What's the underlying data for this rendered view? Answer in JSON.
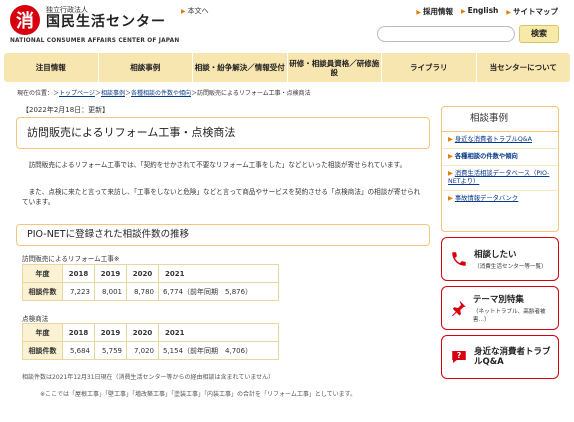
{
  "header": {
    "logo_mark": "消",
    "org_sub": "独立行政法人",
    "org_name": "国民生活センター",
    "org_en": "NATIONAL CONSUMER AFFAIRS CENTER OF JAPAN",
    "honbun": "本文へ",
    "links": [
      "採用情報",
      "English",
      "サイトマップ"
    ],
    "search_placeholder": "",
    "search_button": "検索"
  },
  "nav": [
    "注目情報",
    "相談事例",
    "相談・紛争解決／情報受付",
    "研修・相談員資格／研修施設",
    "ライブラリ",
    "当センターについて"
  ],
  "breadcrumb": {
    "prefix": "現在の位置：",
    "items": [
      "トップページ",
      "相談事例",
      "各種相談の件数や傾向"
    ],
    "current": "訪問販売によるリフォーム工事・点検商法"
  },
  "article": {
    "date": "【2022年2月18日：更新】",
    "title": "訪問販売によるリフォーム工事・点検商法",
    "para1": "　訪問販売によるリフォーム工事では、「契約をせかされて不要なリフォーム工事をした」などといった相談が寄せられています。",
    "para2": "　また、点検に来たと言って来訪し、「工事をしないと危険」などと言って商品やサービスを契約させる「点検商法」の相談が寄せられています。",
    "section_title": "PIO-NETに登録された相談件数の推移",
    "table1_label": "訪問販売によるリフォーム工事※",
    "table2_label": "点検商法",
    "years_label": "年度",
    "count_label": "相談件数",
    "years": [
      "2018",
      "2019",
      "2020",
      "2021"
    ],
    "table1_values": [
      "7,223",
      "8,001",
      "8,780",
      "6,774（前年同期　5,876）"
    ],
    "table2_values": [
      "5,684",
      "5,759",
      "7,020",
      "5,154（前年同期　4,706）"
    ],
    "footnote1": "相談件数は2021年12月31日現在（消費生活センター等からの経由相談は含まれていません）",
    "footnote2": "※ここでは「屋根工事」「壁工事」「増改築工事」「塗装工事」「内装工事」の合計を「リフォーム工事」としています。"
  },
  "sidebar": {
    "heading": "相談事例",
    "items": [
      "身近な消費者トラブルQ&A",
      "各種相談の件数や傾向",
      "消費生活相談データベース（PIO-NETより）",
      "事故情報データバンク"
    ]
  },
  "cards": [
    {
      "title": "相談したい",
      "sub": "（消費生活センター等一覧）",
      "icon": "phone-icon"
    },
    {
      "title": "テーマ別特集",
      "sub": "（ネットトラブル、高齢者被害…）",
      "icon": "pin-icon"
    },
    {
      "title": "身近な消費者トラブルQ&A",
      "sub": "",
      "icon": "question-icon"
    }
  ],
  "colors": {
    "brand_red": "#d7000f",
    "nav_bg": "#f8e6b0",
    "border_gold": "#f0c878"
  }
}
